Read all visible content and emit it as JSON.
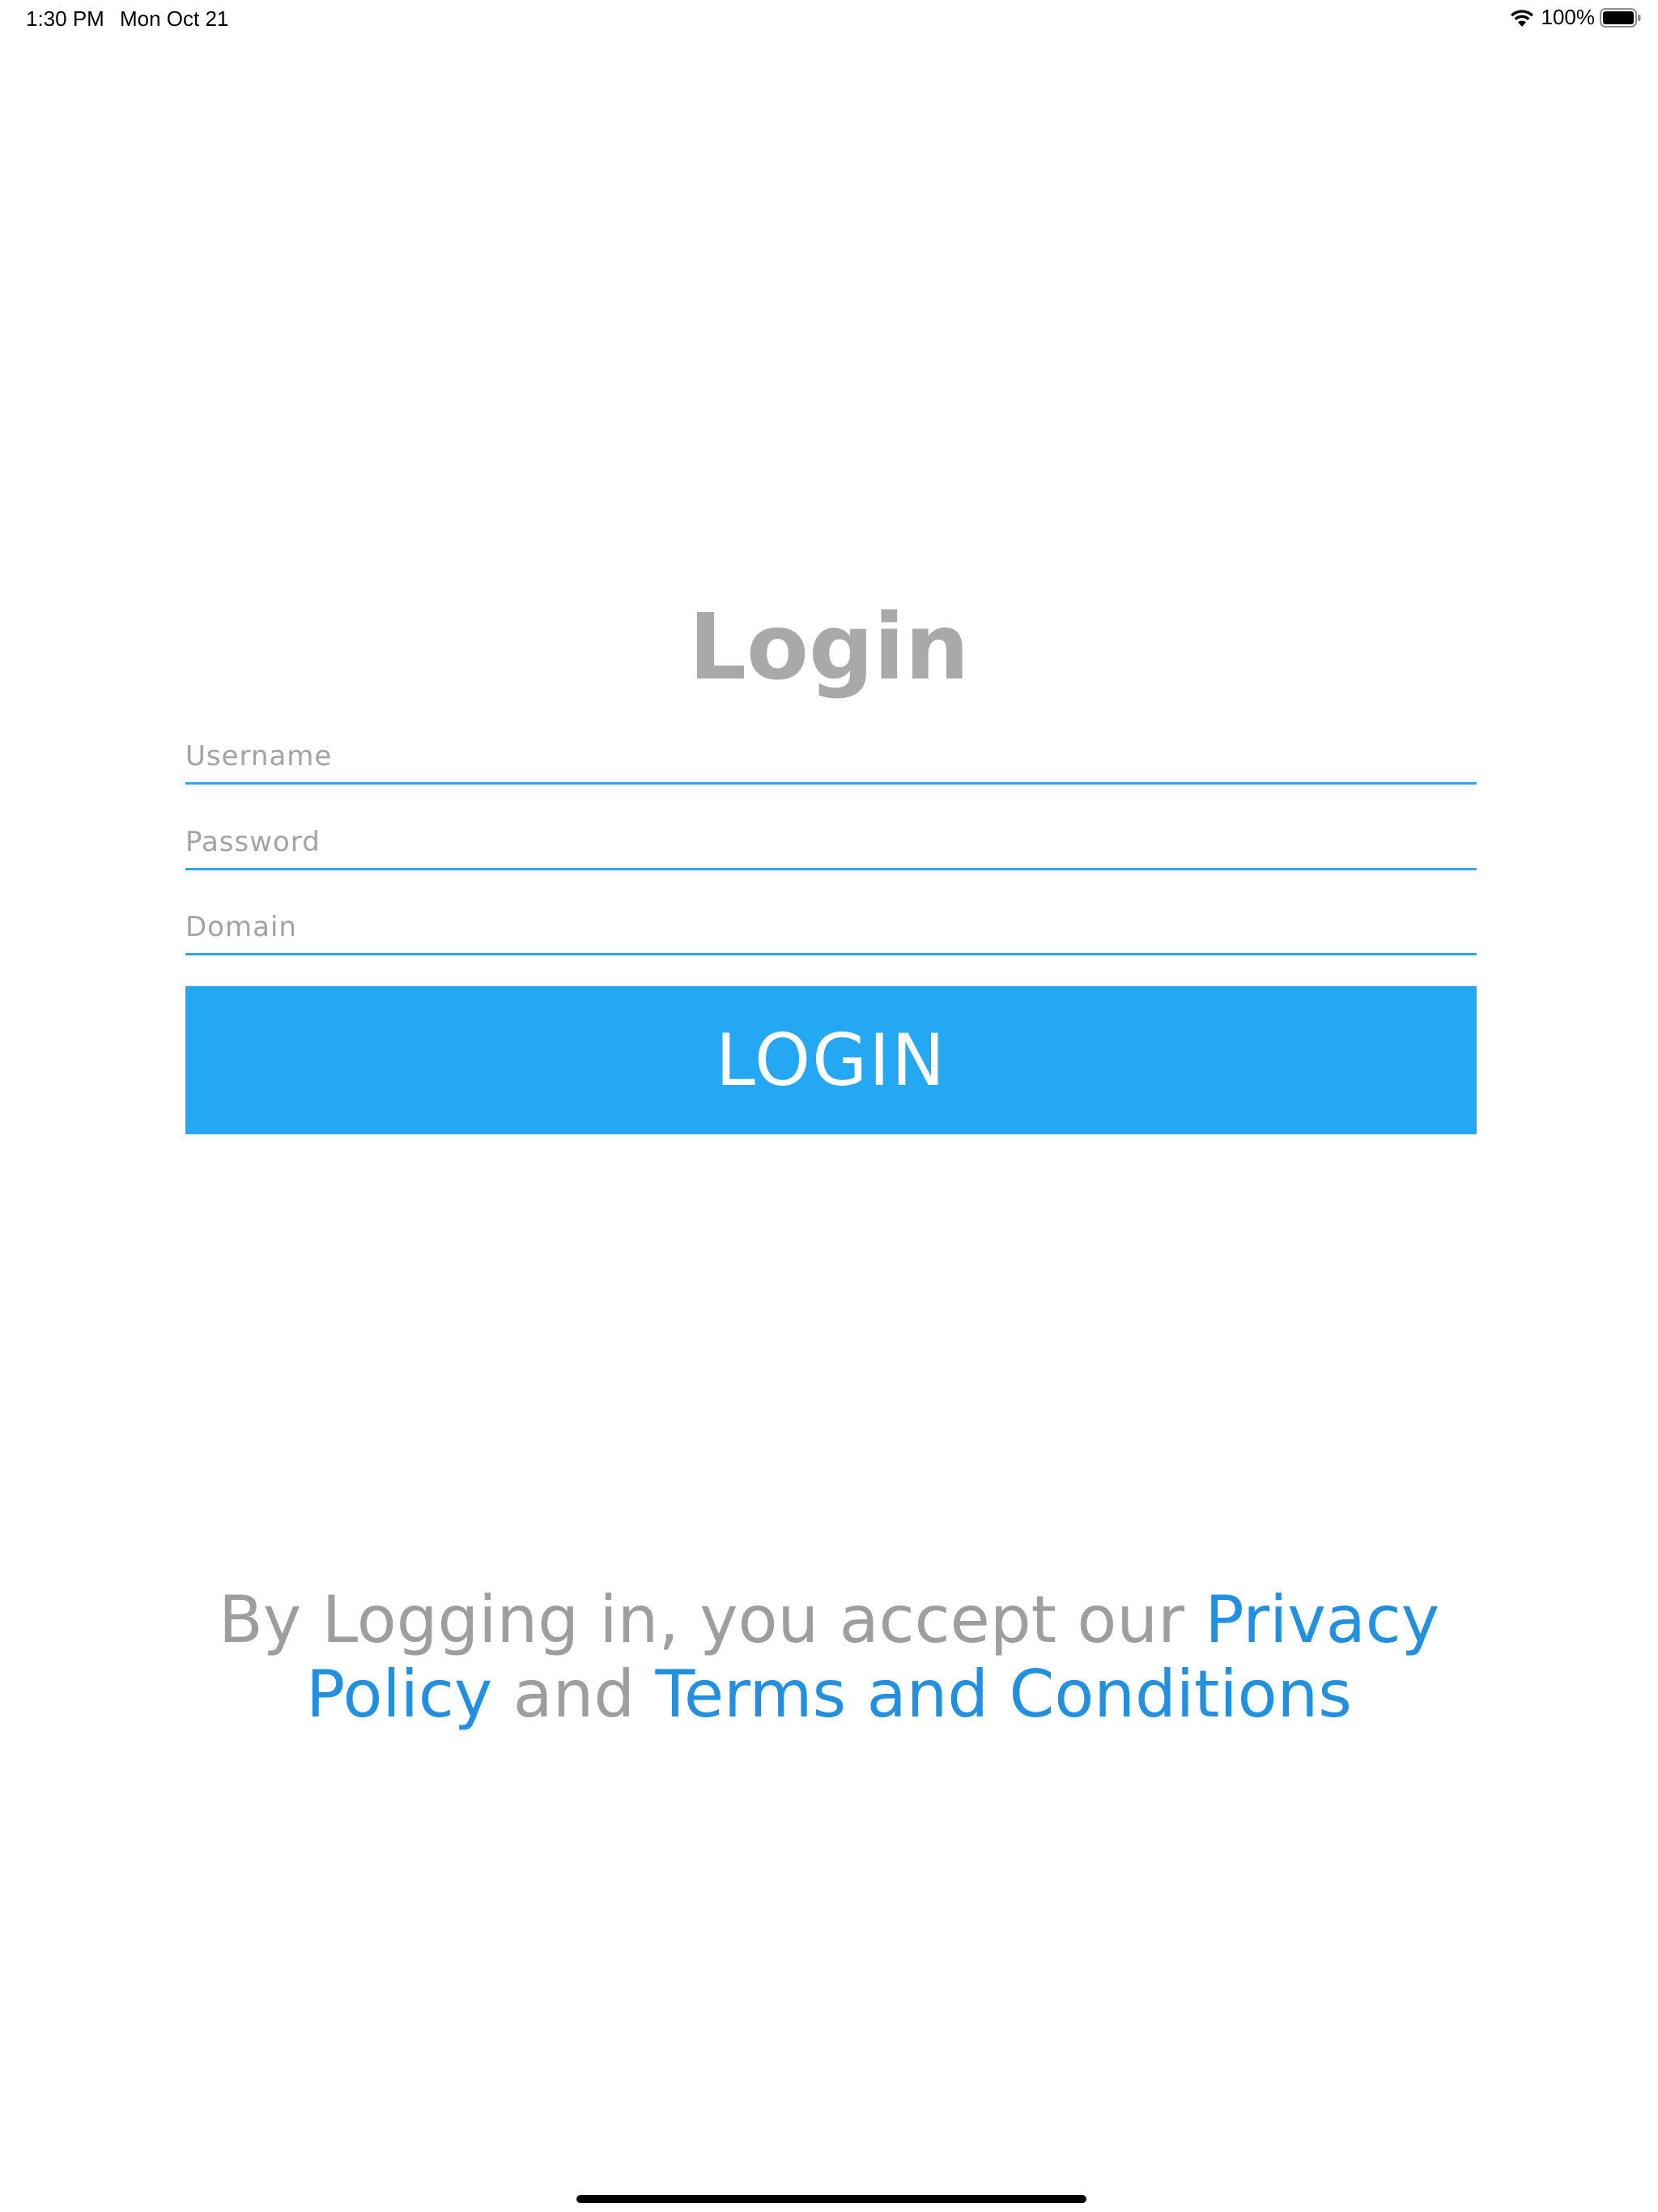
{
  "status_bar": {
    "time": "1:30 PM",
    "date": "Mon Oct 21",
    "battery_percent": "100%",
    "icons": [
      "wifi-icon",
      "battery-icon"
    ]
  },
  "login": {
    "title": "Login",
    "username_placeholder": "Username",
    "password_placeholder": "Password",
    "domain_placeholder": "Domain",
    "button_label": "LOGIN"
  },
  "legal": {
    "prefix": "By Logging in, you accept our ",
    "privacy_link": "Privacy Policy",
    "conjunction": " and ",
    "terms_link": "Terms and Conditions"
  },
  "colors": {
    "accent": "#24a8f3",
    "link": "#2190e0",
    "title_gray": "#a9a9a9",
    "text_gray": "#9e9e9e"
  }
}
